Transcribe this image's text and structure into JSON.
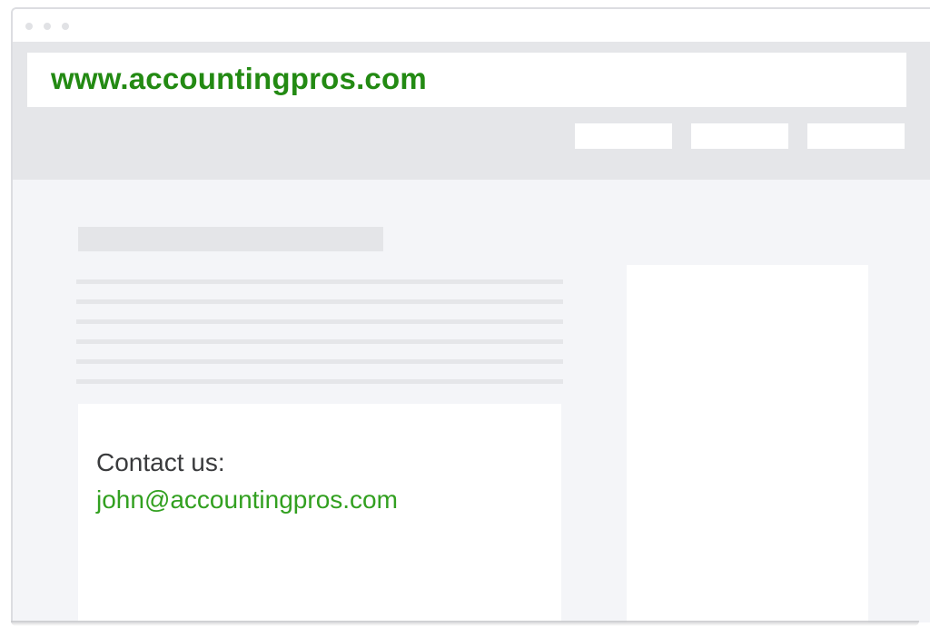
{
  "window": {
    "title_dots": [
      "dot",
      "dot",
      "dot"
    ]
  },
  "header": {
    "url": "www.accountingpros.com",
    "nav_buttons": [
      "",
      "",
      ""
    ]
  },
  "main": {
    "contact": {
      "label": "Contact us:",
      "email": "john@accountingpros.com"
    }
  },
  "colors": {
    "brand_green": "#238a13",
    "email_green": "#32a020",
    "header_bg": "#e5e6e9",
    "page_bg": "#f4f5f8"
  }
}
